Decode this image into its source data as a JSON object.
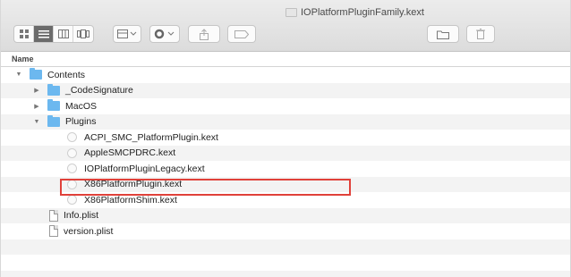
{
  "window": {
    "title": "IOPlatformPluginFamily.kext"
  },
  "toolbar": {
    "view_modes": [
      "icon-view",
      "list-view",
      "column-view",
      "cover-flow-view"
    ],
    "active_view": "list-view"
  },
  "columns": {
    "name_header": "Name"
  },
  "rows": [
    {
      "label": "Contents",
      "kind": "folder",
      "expanded": true
    },
    {
      "label": "_CodeSignature",
      "kind": "folder",
      "expanded": false
    },
    {
      "label": "MacOS",
      "kind": "folder",
      "expanded": false
    },
    {
      "label": "Plugins",
      "kind": "folder",
      "expanded": true
    },
    {
      "label": "ACPI_SMC_PlatformPlugin.kext",
      "kind": "kext"
    },
    {
      "label": "AppleSMCPDRC.kext",
      "kind": "kext"
    },
    {
      "label": "IOPlatformPluginLegacy.kext",
      "kind": "kext"
    },
    {
      "label": "X86PlatformPlugin.kext",
      "kind": "kext",
      "highlighted": true
    },
    {
      "label": "X86PlatformShim.kext",
      "kind": "kext"
    },
    {
      "label": "Info.plist",
      "kind": "plist"
    },
    {
      "label": "version.plist",
      "kind": "plist"
    }
  ],
  "colors": {
    "folder": "#6cb8ef",
    "highlight_border": "#e0413a",
    "toolbar_bg": "#e3e3e3"
  }
}
